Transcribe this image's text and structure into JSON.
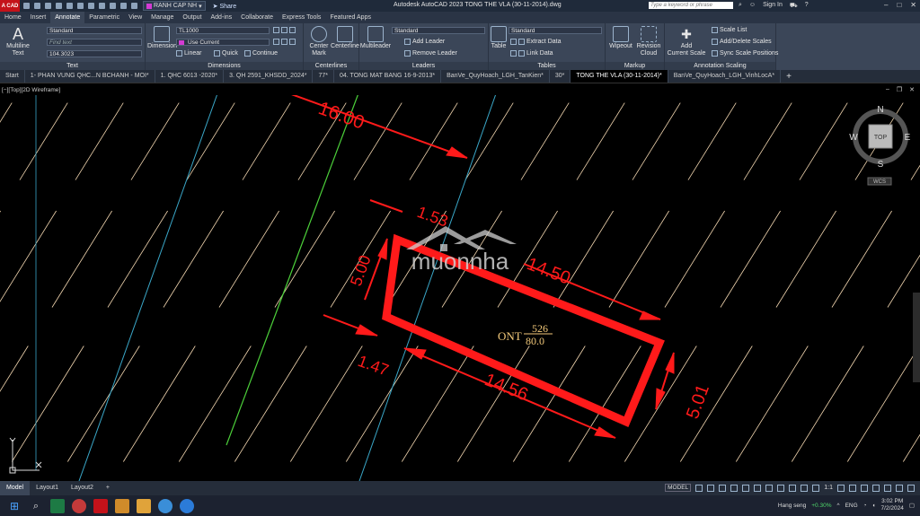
{
  "titlebar": {
    "workspace": "RANH CAP NH",
    "share": "Share",
    "title": "Autodesk AutoCAD 2023    TONG THE VLA (30-11-2014).dwg",
    "search_placeholder": "Type a keyword or phrase",
    "signin": "Sign In"
  },
  "ribbon_tabs": [
    "Home",
    "Insert",
    "Annotate",
    "Parametric",
    "View",
    "Manage",
    "Output",
    "Add-ins",
    "Collaborate",
    "Express Tools",
    "Featured Apps"
  ],
  "ribbon": {
    "text_panel": {
      "multiline": "Multiline",
      "text": "Text",
      "style": "Standard",
      "find_placeholder": "Find text",
      "height": "104.3023",
      "label": "Text"
    },
    "dimensions_panel": {
      "dimension": "Dimension",
      "dimstyle": "TL1000",
      "layer": "Use Current",
      "linear": "Linear",
      "quick": "Quick",
      "continue": "Continue",
      "label": "Dimensions"
    },
    "centerlines_panel": {
      "center_mark": "Center",
      "center_mark2": "Mark",
      "centerline": "Centerline",
      "label": "Centerlines"
    },
    "leaders_panel": {
      "multileader": "Multileader",
      "style": "Standard",
      "add": "Add Leader",
      "remove": "Remove Leader",
      "label": "Leaders"
    },
    "tables_panel": {
      "table": "Table",
      "style": "Standard",
      "extract": "Extract Data",
      "link": "Link Data",
      "label": "Tables"
    },
    "markup_panel": {
      "wipeout": "Wipeout",
      "revision": "Revision",
      "revision2": "Cloud",
      "label": "Markup"
    },
    "annotation_scaling_panel": {
      "add": "Add",
      "add2": "Current Scale",
      "scale_list": "Scale List",
      "add_delete": "Add/Delete Scales",
      "sync": "Sync Scale Positions",
      "label": "Annotation Scaling"
    }
  },
  "doc_tabs": [
    "Start",
    "1- PHAN VUNG QHC...N BCHANH - MOI*",
    "1. QHC 6013 -2020*",
    "3. QH 2591_KHSDD_2024*",
    "77*",
    "04. TONG MAT BANG 16-9-2013*",
    "BanVe_QuyHoach_LGH_TanKien*",
    "30*",
    "TONG THE VLA (30-11-2014)*",
    "BanVe_QuyHoach_LGH_VinhLocA*"
  ],
  "active_doc_tab": 8,
  "viewport_label": "[−][Top][2D Wireframe]",
  "viewcube": {
    "n": "N",
    "s": "S",
    "e": "E",
    "w": "W",
    "top": "TOP",
    "wcs": "WCS"
  },
  "drawing": {
    "dims": {
      "top": "16.00",
      "short_top": "1.53",
      "left": "5.00",
      "long_top": "14.50",
      "bottom_left": "1.47",
      "long_bottom": "14.56",
      "right": "5.01"
    },
    "lot_label": "ONT",
    "lot_number": "526",
    "lot_area": "80.0",
    "watermark": "muonnha",
    "colors": {
      "lot": "#ff1a1a",
      "hatch": "#f2d6b0",
      "cyan": "#3aa7c8",
      "green": "#4ccf3a"
    }
  },
  "layout_tabs": [
    "Model",
    "Layout1",
    "Layout2"
  ],
  "status": {
    "model": "MODEL",
    "scale": "1:1"
  },
  "taskbar": {
    "stock": "Hang seng",
    "stock_change": "+0.30%",
    "lang": "ENG",
    "time": "3:02 PM",
    "date": "7/2/2024"
  }
}
